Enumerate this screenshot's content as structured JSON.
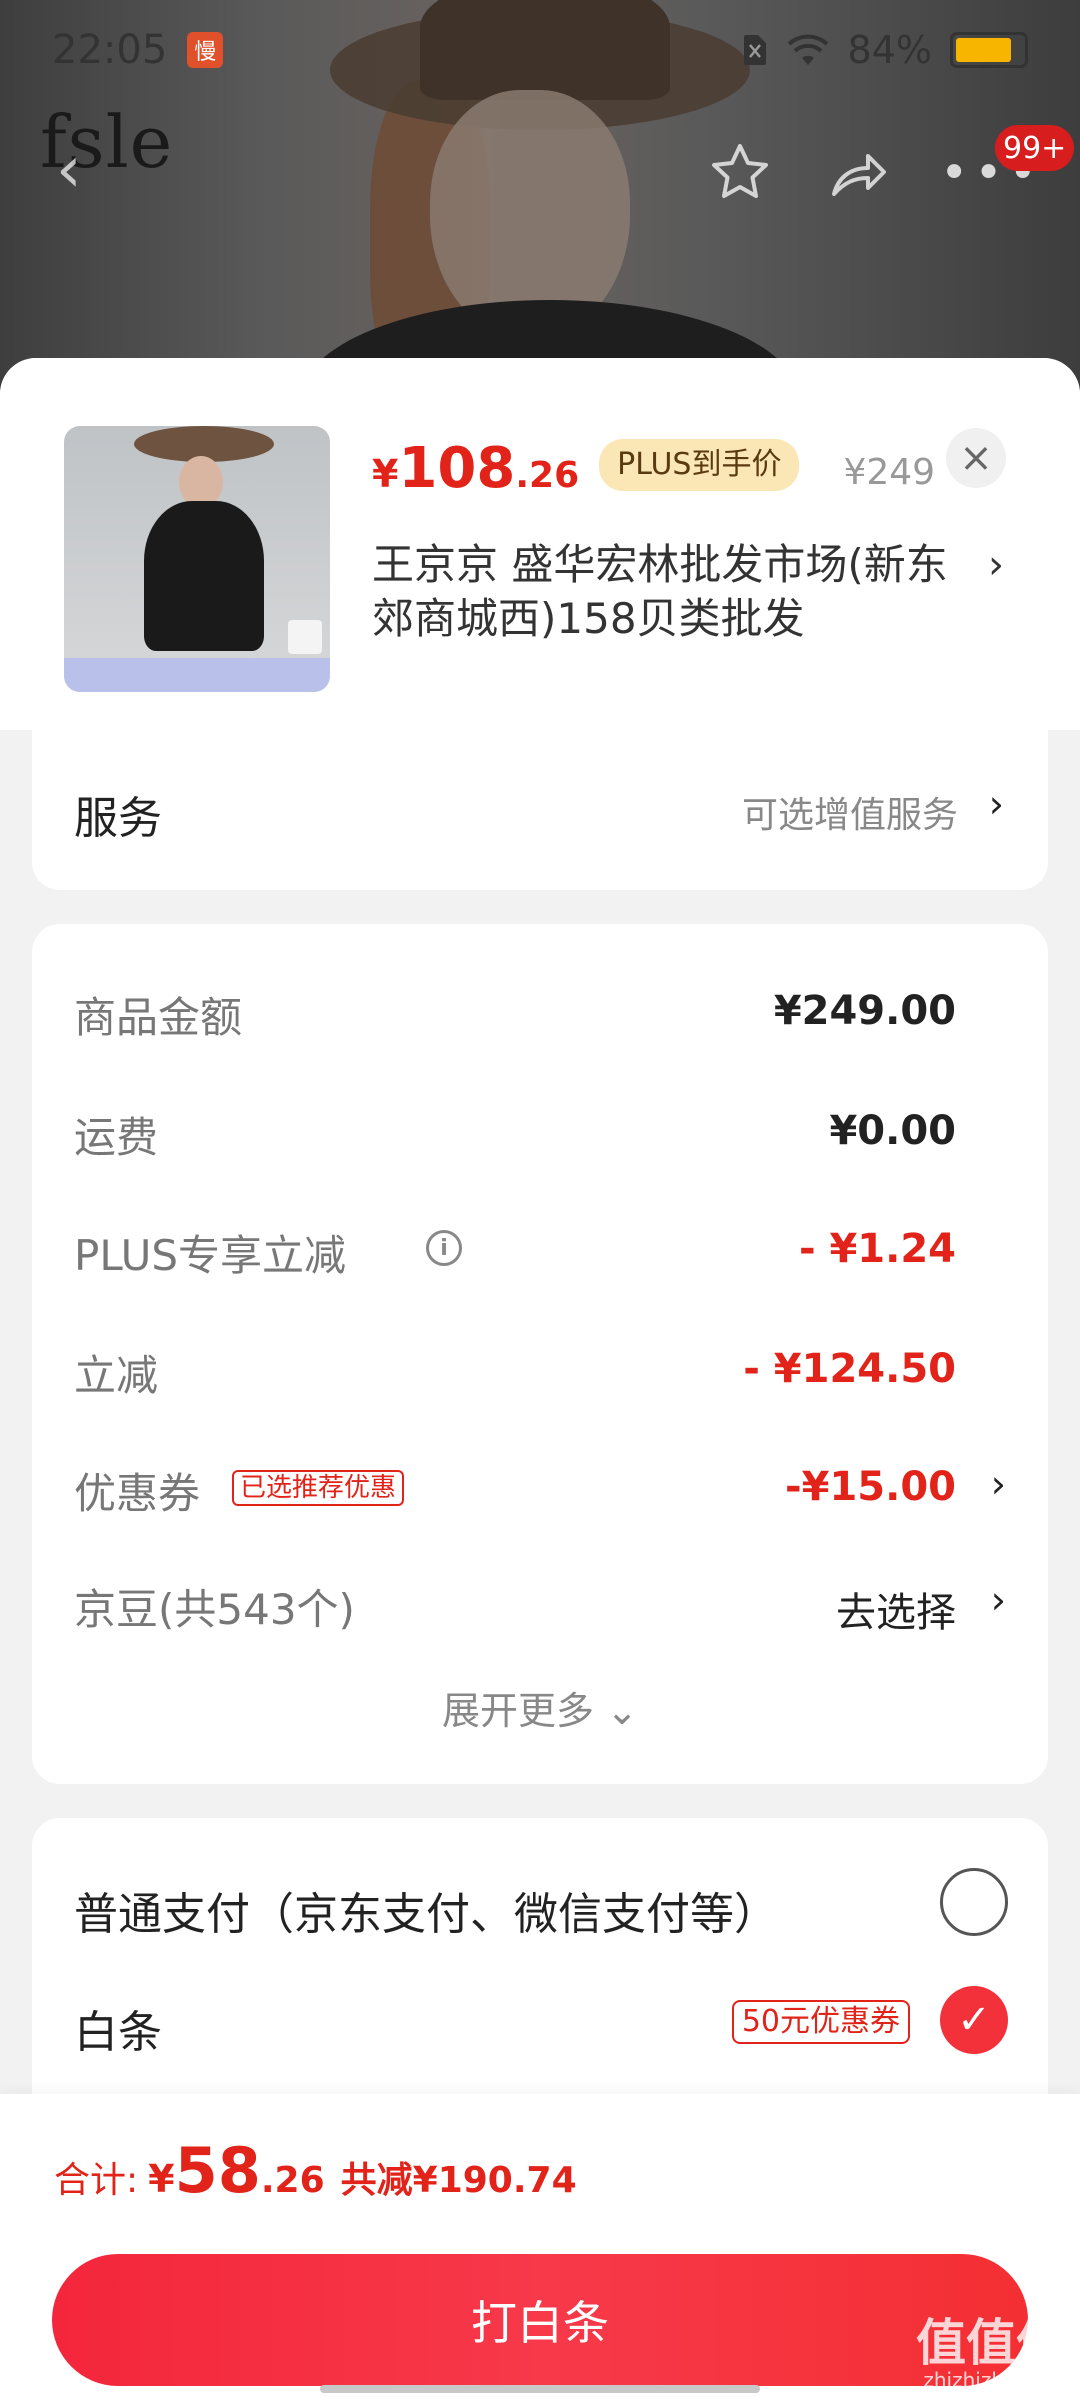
{
  "status_bar": {
    "time": "22:05",
    "app_badge": "慢",
    "battery": "84%",
    "battery_level": 0.84
  },
  "header": {
    "brand": "fsle",
    "message_badge": "99+"
  },
  "product": {
    "price_symbol": "¥",
    "price_int": "108",
    "price_dec": ".26",
    "plus_tag": "PLUS到手价",
    "original_price": "¥249",
    "close": "×",
    "address": "王京京  盛华宏林批发市场(新东郊商城西)158贝类批发",
    "address_arrow": "›"
  },
  "service": {
    "title": "服务",
    "hint": "可选增值服务",
    "arrow": "›"
  },
  "amounts": {
    "rows": [
      {
        "label": "商品金额",
        "value": "¥249.00"
      },
      {
        "label": "运费",
        "value": "¥0.00"
      },
      {
        "label": "PLUS专享立减",
        "value": "- ¥1.24"
      },
      {
        "label": "立减",
        "value": "- ¥124.50"
      },
      {
        "label": "优惠券",
        "tag": "已选推荐优惠",
        "value": "-¥15.00"
      },
      {
        "label": "京豆(共543个)",
        "value": "去选择"
      }
    ],
    "expand": "展开更多 ⌄",
    "info_icon": "i"
  },
  "payment": {
    "normal": "普通支付（京东支付、微信支付等）",
    "baitiao": "白条",
    "baitiao_coupon": "50元优惠券",
    "check": "✓"
  },
  "bottom": {
    "total_label": "合计:",
    "total_symbol": "¥",
    "total_int": "58",
    "total_dec": ".26",
    "total_save": "共减¥190.74",
    "pay_button": "打白条"
  },
  "watermark": {
    "line1": "值值值",
    "line2": "zhizhizhi.com"
  },
  "colors": {
    "accent": "#e2231a",
    "button": "#f4263b",
    "plus_tag_bg": "#fbe7b6"
  }
}
